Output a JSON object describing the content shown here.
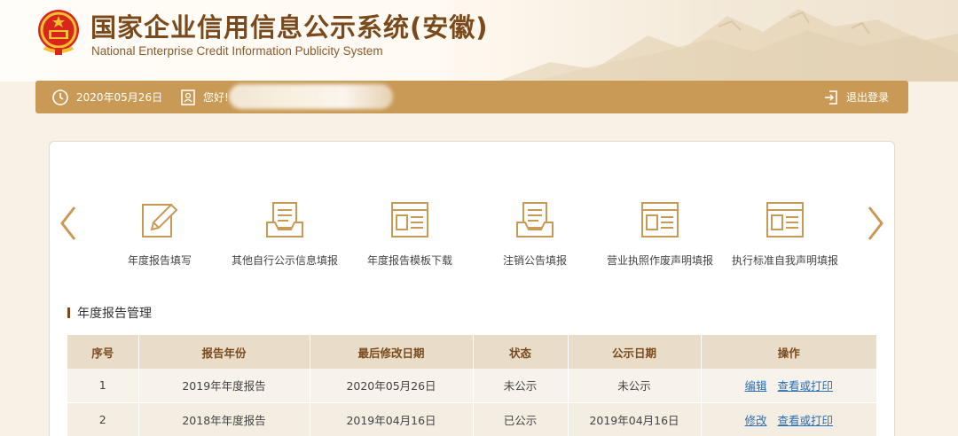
{
  "header": {
    "title": "国家企业信用信息公示系统(安徽)",
    "subtitle": "National Enterprise Credit Information Publicity System"
  },
  "topbar": {
    "date": "2020年05月26日",
    "greeting": "您好!",
    "logout_label": "退出登录"
  },
  "functions": [
    {
      "label": "年度报告填写",
      "icon": "pencil-edit-icon"
    },
    {
      "label": "其他自行公示信息填报",
      "icon": "document-tray-icon"
    },
    {
      "label": "年度报告模板下载",
      "icon": "template-icon"
    },
    {
      "label": "注销公告填报",
      "icon": "document-tray-icon"
    },
    {
      "label": "营业执照作废声明填报",
      "icon": "template-icon"
    },
    {
      "label": "执行标准自我声明填报",
      "icon": "template-icon"
    }
  ],
  "section": {
    "title": "年度报告管理"
  },
  "table": {
    "headers": [
      "序号",
      "报告年份",
      "最后修改日期",
      "状态",
      "公示日期",
      "操作"
    ],
    "rows": [
      {
        "index": "1",
        "year": "2019年年度报告",
        "modified": "2020年05月26日",
        "status": "未公示",
        "publish_date": "未公示",
        "action1": "编辑",
        "action2": "查看或打印"
      },
      {
        "index": "2",
        "year": "2018年年度报告",
        "modified": "2019年04月16日",
        "status": "已公示",
        "publish_date": "2019年04月16日",
        "action1": "修改",
        "action2": "查看或打印"
      }
    ]
  },
  "colors": {
    "brand_brown": "#7a4a1c",
    "topbar_gold": "#c99a55",
    "header_cell": "#e9ddca",
    "link_blue": "#2c6fb5"
  }
}
